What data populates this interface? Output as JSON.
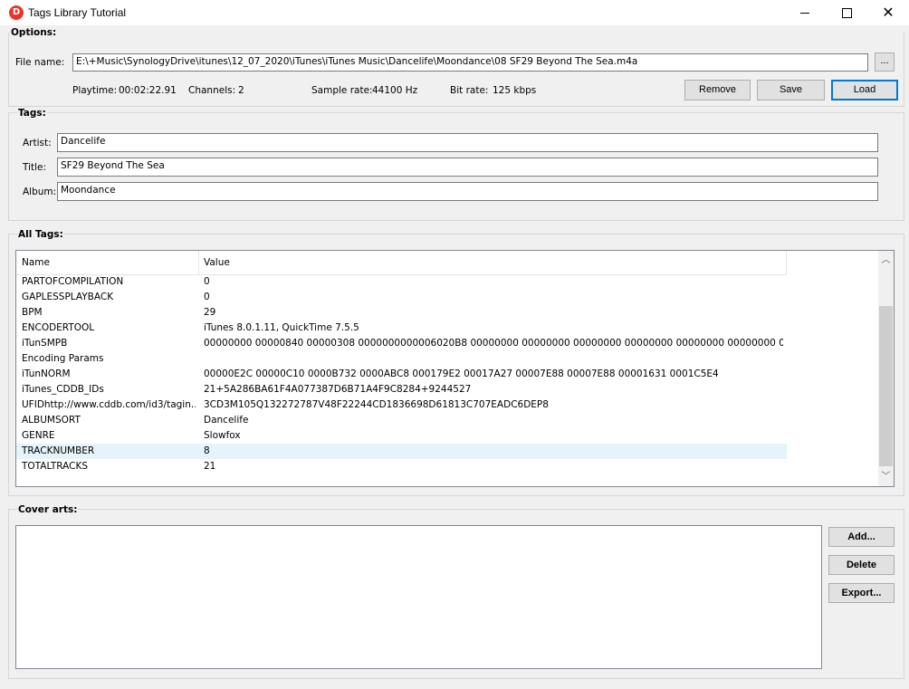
{
  "window": {
    "title": "Tags Library Tutorial",
    "icon_letter": "D",
    "accent": "#e8342c",
    "min_icon": "minimize-icon",
    "max_icon": "maximize-icon",
    "close_icon": "close-icon",
    "close_glyph": "✕"
  },
  "options": {
    "group_label": "Options:",
    "file_name_label": "File name:",
    "file_name_value": "E:\\+Music\\SynologyDrive\\itunes\\12_07_2020\\iTunes\\iTunes Music\\Dancelife\\Moondance\\08 SF29 Beyond The Sea.m4a",
    "browse_label": "...",
    "playtime_label": "Playtime:",
    "playtime_value": "00:02:22.91",
    "channels_label": "Channels:",
    "channels_value": "2",
    "sample_rate_label": "Sample rate:",
    "sample_rate_value": "44100 Hz",
    "bit_rate_label": "Bit rate:",
    "bit_rate_value": "125 kbps",
    "remove_label": "Remove",
    "save_label": "Save",
    "load_label": "Load"
  },
  "tags": {
    "group_label": "Tags:",
    "artist_label": "Artist:",
    "artist_value": "Dancelife",
    "title_label": "Title:",
    "title_value": "SF29 Beyond The Sea",
    "album_label": "Album:",
    "album_value": "Moondance"
  },
  "all_tags": {
    "group_label": "All Tags:",
    "columns": [
      "Name",
      "Value"
    ],
    "rows": [
      {
        "name": "PARTOFCOMPILATION",
        "value": "0"
      },
      {
        "name": "GAPLESSPLAYBACK",
        "value": "0"
      },
      {
        "name": "BPM",
        "value": "29"
      },
      {
        "name": "ENCODERTOOL",
        "value": "iTunes 8.0.1.11, QuickTime 7.5.5"
      },
      {
        "name": "iTunSMPB",
        "value": " 00000000 00000840 00000308 0000000000006020B8 00000000 00000000 00000000 00000000 00000000 00000000 00000000 00..."
      },
      {
        "name": "Encoding Params",
        "value": ""
      },
      {
        "name": "iTunNORM",
        "value": " 00000E2C 00000C10 0000B732 0000ABC8 000179E2 00017A27 00007E88 00007E88 00001631 0001C5E4"
      },
      {
        "name": "iTunes_CDDB_IDs",
        "value": "21+5A286BA61F4A077387D6B71A4F9C8284+9244527"
      },
      {
        "name": "UFIDhttp://www.cddb.com/id3/tagin...",
        "value": "3CD3M105Q132272787V48F22244CD1836698D61813C707EADC6DEP8"
      },
      {
        "name": "ALBUMSORT",
        "value": "Dancelife"
      },
      {
        "name": "GENRE",
        "value": "Slowfox"
      },
      {
        "name": "TRACKNUMBER",
        "value": "8"
      },
      {
        "name": "TOTALTRACKS",
        "value": "21"
      }
    ],
    "selected_row": 11
  },
  "cover_arts": {
    "group_label": "Cover arts:",
    "add_label": "Add...",
    "delete_label": "Delete",
    "export_label": "Export..."
  }
}
